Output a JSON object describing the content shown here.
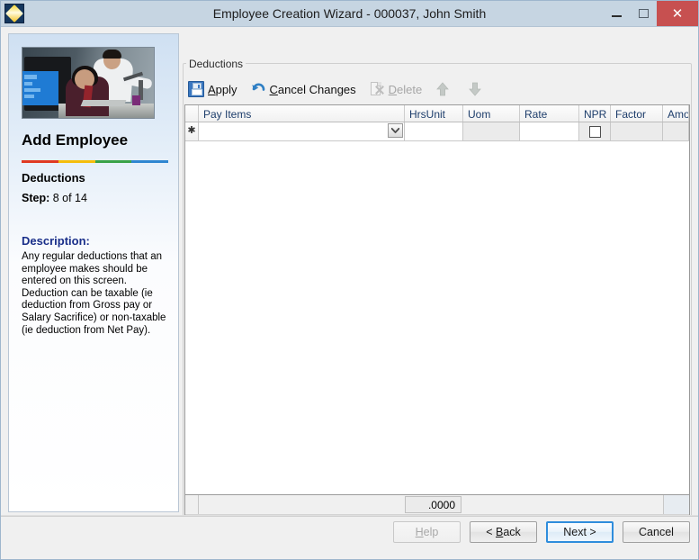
{
  "window": {
    "title": "Employee Creation Wizard  - 000037, John Smith",
    "icon": "app-diamond-icon",
    "buttons": {
      "minimize": "minimize-icon",
      "maximize": "maximize-icon",
      "close": "✕"
    }
  },
  "wizard": {
    "photo_alt": "office-workers-photo",
    "heading": "Add Employee",
    "divider_colors": [
      "#e03a22",
      "#f5bd0c",
      "#3aa248",
      "#2f86d0"
    ],
    "step_title": "Deductions",
    "step_label": "Step:",
    "step_value": " 8 of 14",
    "description_label": "Description:",
    "description_text": "Any regular deductions that an employee makes should be entered on this screen. Deduction can be taxable (ie deduction from Gross pay or Salary Sacrifice) or non-taxable (ie deduction from Net Pay)."
  },
  "group": {
    "label": "Deductions"
  },
  "toolbar": {
    "apply": {
      "label_pre": "",
      "accel": "A",
      "label_post": "pply",
      "icon": "save-icon",
      "enabled": true
    },
    "cancel_changes": {
      "label_pre": "",
      "accel": "C",
      "label_post": "ancel Changes",
      "icon": "undo-icon",
      "enabled": true
    },
    "delete": {
      "label_pre": "",
      "accel": "D",
      "label_post": "elete",
      "icon": "delete-icon",
      "enabled": false
    },
    "move_up": {
      "icon": "arrow-up-icon",
      "enabled": false
    },
    "move_down": {
      "icon": "arrow-down-icon",
      "enabled": false
    }
  },
  "grid": {
    "columns": [
      {
        "key": "rowsel",
        "label": ""
      },
      {
        "key": "payitems",
        "label": "Pay Items"
      },
      {
        "key": "hrsunit",
        "label": "HrsUnit"
      },
      {
        "key": "uom",
        "label": "Uom"
      },
      {
        "key": "rate",
        "label": "Rate"
      },
      {
        "key": "npr",
        "label": "NPR"
      },
      {
        "key": "factor",
        "label": "Factor"
      },
      {
        "key": "amount",
        "label": "Amoun"
      }
    ],
    "new_row_marker": "✱",
    "row": {
      "payitems": "",
      "payitems_placeholder": "",
      "hrsunit": "",
      "uom": "",
      "rate": "",
      "npr_checked": false,
      "factor": "",
      "amount": ""
    },
    "footer_total": ".0000",
    "hscroll": {
      "left_arrow": "❮",
      "right_arrow": "❯",
      "thumb_percent": 55
    }
  },
  "footer": {
    "help": {
      "accel": "H",
      "pre": "",
      "post": "elp",
      "enabled": false
    },
    "back": {
      "accel": "B",
      "pre": "< ",
      "post": "ack",
      "enabled": true
    },
    "next": {
      "accel": "",
      "pre": "Next >",
      "post": "",
      "enabled": true,
      "default": true
    },
    "cancel": {
      "accel": "",
      "pre": "Cancel",
      "post": "",
      "enabled": true
    }
  }
}
